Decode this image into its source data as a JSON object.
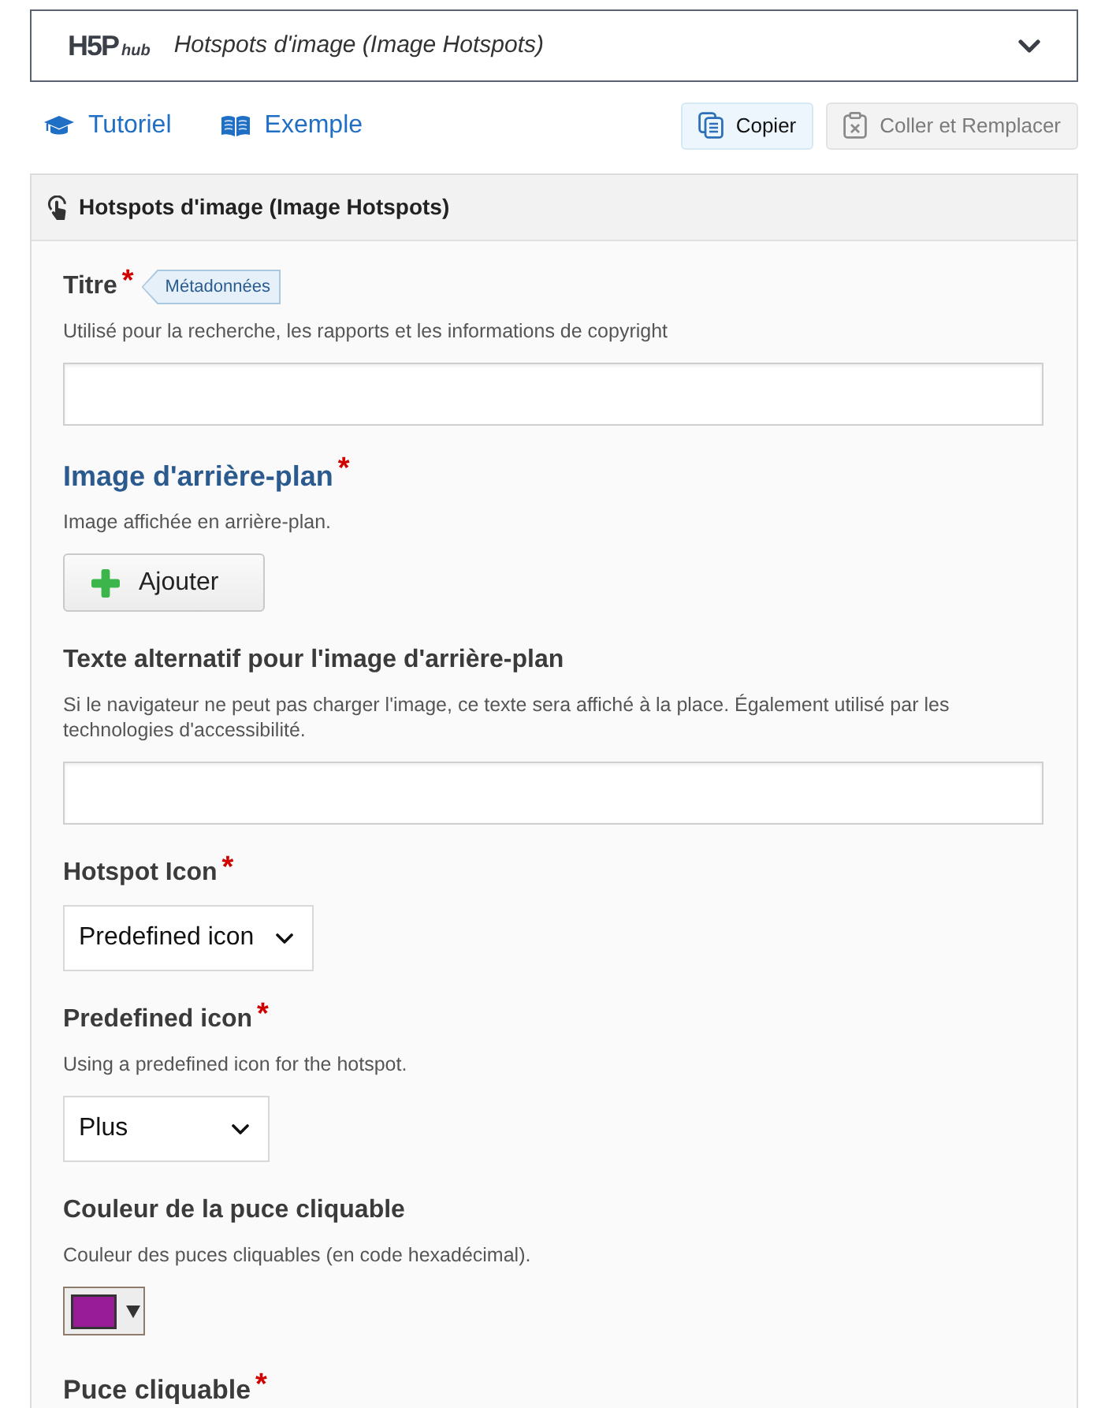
{
  "hub": {
    "logo": "H5P",
    "logo_suffix": "hub",
    "title": "Hotspots d'image (Image Hotspots)",
    "expanded": false
  },
  "help_links": [
    {
      "kind": "tutorial",
      "label": "Tutoriel"
    },
    {
      "kind": "example",
      "label": "Exemple"
    }
  ],
  "actions": [
    {
      "kind": "copy",
      "label": "Copier",
      "disabled": false
    },
    {
      "kind": "paste",
      "label": "Coller et Remplacer",
      "disabled": true
    }
  ],
  "panel": {
    "title": "Hotspots d'image (Image Hotspots)",
    "fields": [
      {
        "kind": "text",
        "label": "Titre",
        "required_mark": "*",
        "tag": "Métadonnées",
        "description": "Utilisé pour la recherche, les rapports et les informations de copyright"
      },
      {
        "kind": "image",
        "label": "Image d'arrière-plan",
        "required_mark": "*",
        "description": "Image affichée en arrière-plan.",
        "button": "Ajouter"
      },
      {
        "kind": "text",
        "label": "Texte alternatif pour l'image d'arrière-plan",
        "description": "Si le navigateur ne peut pas charger l'image, ce texte sera affiché à la place. Également utilisé par les technologies d'accessibilité."
      },
      {
        "kind": "select",
        "label": "Hotspot Icon",
        "required_mark": "*",
        "value": "Predefined icon"
      },
      {
        "kind": "select",
        "label": "Predefined icon",
        "required_mark": "*",
        "description": "Using a predefined icon for the hotspot.",
        "value": "Plus"
      },
      {
        "kind": "color",
        "label": "Couleur de la puce cliquable",
        "description": "Couleur des puces cliquables (en code hexadécimal).",
        "color": "#981b97"
      },
      {
        "kind": "group",
        "label": "Puce cliquable",
        "required_mark": "*"
      }
    ]
  }
}
